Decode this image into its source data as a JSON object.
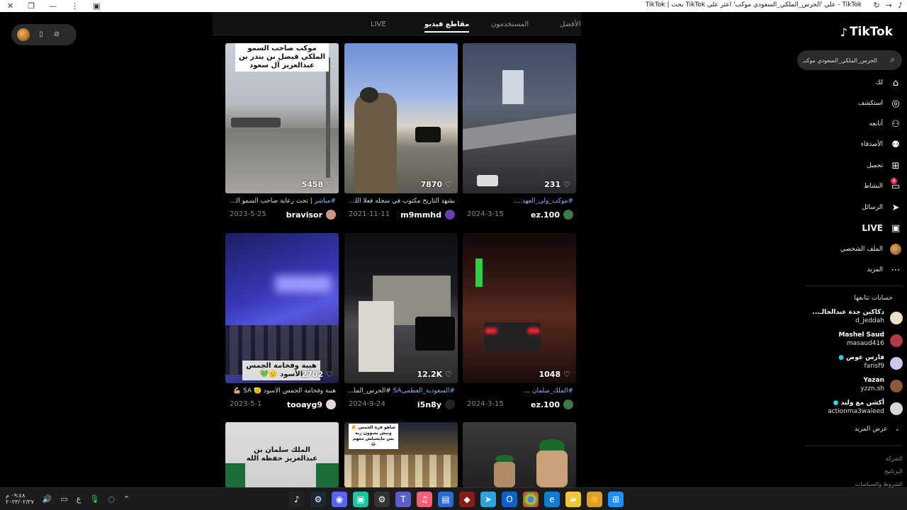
{
  "window": {
    "title": "TikTok - علي 'الحرس_الملكي_السعودي موكب' اعثر على TikTok بحث | TikTok"
  },
  "tabs": [
    {
      "label": "الأفضل",
      "active": false
    },
    {
      "label": "المستخدمون",
      "active": false
    },
    {
      "label": "مقاطع فيديو",
      "active": true
    },
    {
      "label": "LIVE",
      "active": false
    }
  ],
  "videos": [
    {
      "likes": "5458",
      "caption_tag": "#مباشر",
      "caption": " | تحت رعاية صاحب السمو الملك...",
      "date": "2023-5-25",
      "user": "bravisor",
      "overlay": "موكب صاحب السمو الملكي فيصل بن بندر بن عبدالعزيز آل سعود"
    },
    {
      "likes": "7870",
      "caption_tag": "",
      "caption": "يشهد التاريخ مكتوب في سجله فعلا اللي ر...",
      "date": "2021-11-11",
      "user": "m9mmhd",
      "overlay": ""
    },
    {
      "likes": "231",
      "caption_tag": "#موكب_ولي_العهد",
      "caption": " ...",
      "date": "2024-3-15",
      "user": "ez.100",
      "overlay": ""
    },
    {
      "likes": "2702",
      "caption_tag": "",
      "caption": "هيبة وفخامة الجمس الاسود 🫡 SA 💪🏼",
      "date": "2023-5-1",
      "user": "tooayg9",
      "overlay": "هيبة وفخامة الجمس الأسود 🫡💚"
    },
    {
      "likes": "12.2K",
      "caption_tag": "#السعودية_العظمىSA",
      "caption": " #الحرس_الملكي...",
      "date": "2024-9-24",
      "user": "i5n8y",
      "overlay": ""
    },
    {
      "likes": "1048",
      "caption_tag": "#الملك_سلمان",
      "caption": " ...",
      "date": "2024-3-15",
      "user": "ez.100",
      "overlay": ""
    },
    {
      "likes": "",
      "caption_tag": "",
      "caption": "",
      "date": "",
      "user": "",
      "overlay": "الملك سلمان بن عبدالعزيز حفظه الله"
    },
    {
      "likes": "",
      "caption_tag": "",
      "caption": "",
      "date": "",
      "user": "",
      "overlay": "شاهو فرة الجمس 🔥 وبيش يسوون زبه بس مايشيلش معهم 😂"
    },
    {
      "likes": "",
      "caption_tag": "",
      "caption": "",
      "date": "",
      "user": "",
      "overlay": ""
    }
  ],
  "sidebar": {
    "logo": "TikTok",
    "search_value": "الحرس_الملكي_السعودي موكب",
    "nav": [
      {
        "label": "لك",
        "icon": "home-icon"
      },
      {
        "label": "استكشف",
        "icon": "compass-icon"
      },
      {
        "label": "أتابعه",
        "icon": "following-icon"
      },
      {
        "label": "الأصدقاء",
        "icon": "friends-icon"
      },
      {
        "label": "تحميل",
        "icon": "upload-icon"
      },
      {
        "label": "النشاط",
        "icon": "activity-icon",
        "badge": "4"
      },
      {
        "label": "الرسائل",
        "icon": "messages-icon"
      },
      {
        "label": "LIVE",
        "icon": "live-icon"
      },
      {
        "label": "الملف الشخصي",
        "icon": "profile-icon"
      },
      {
        "label": "المزيد",
        "icon": "more-icon"
      }
    ],
    "following_title": "حسابات تتابعها",
    "accounts": [
      {
        "name": "دكاكين جدة عبدالخالـ...",
        "handle": "d_jeddah",
        "color": "#e9e2c8"
      },
      {
        "name": "Mashel Saud",
        "handle": "masaud416",
        "color": "#b03a4a"
      },
      {
        "name": "فارس عوض",
        "handle": "farisf9",
        "color": "#c7c9e8",
        "verified": true
      },
      {
        "name": "Yazan",
        "handle": "yzzn.sh",
        "color": "#8a5a3a"
      },
      {
        "name": "أكشن مع وليد",
        "handle": "actionma3waleed",
        "color": "#d7d7d7",
        "verified": true
      }
    ],
    "see_more": "عرض المزيد",
    "footer": [
      "الشركة",
      "البرنامج",
      "الشروط والسياسات"
    ]
  },
  "taskbar": {
    "time": "٠٩:٤٨ م",
    "date": "٢٠٢٣/٠٢/٢٧"
  }
}
